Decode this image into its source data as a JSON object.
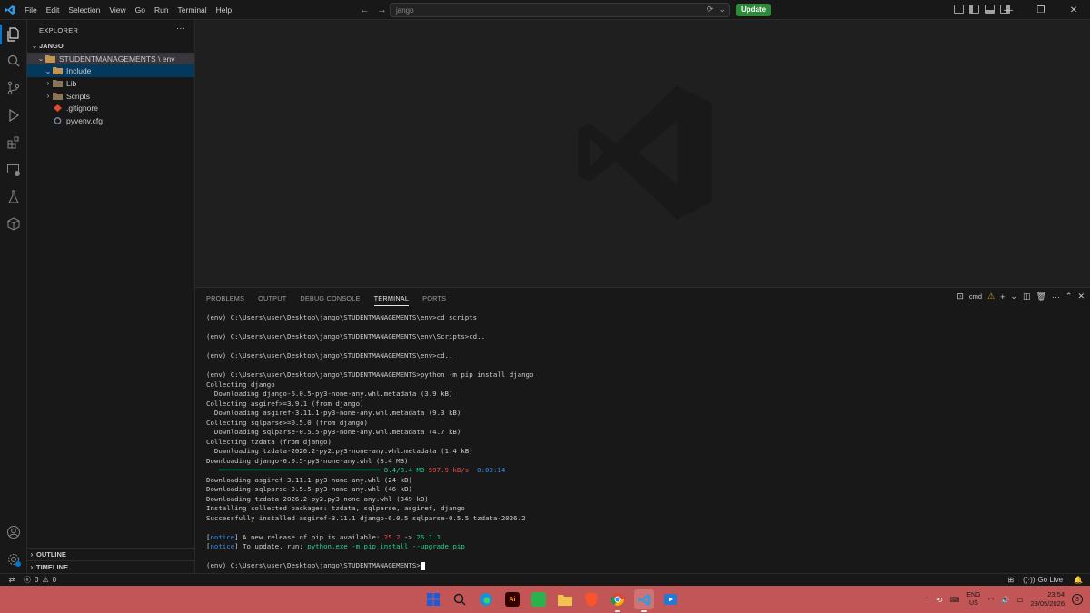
{
  "titlebar": {
    "menus": [
      "File",
      "Edit",
      "Selection",
      "View",
      "Go",
      "Run",
      "Terminal",
      "Help"
    ],
    "search_text": "jango",
    "update_label": "Update"
  },
  "sidebar": {
    "title": "EXPLORER",
    "workspace": "JANGO",
    "tree": [
      {
        "label": "STUDENTMANAGEMENTS \\ env",
        "indent": 0,
        "kind": "folder-open",
        "state": "selected"
      },
      {
        "label": "Include",
        "indent": 1,
        "kind": "folder-open",
        "state": "focused"
      },
      {
        "label": "Lib",
        "indent": 1,
        "kind": "folder",
        "state": ""
      },
      {
        "label": "Scripts",
        "indent": 1,
        "kind": "folder",
        "state": ""
      },
      {
        "label": ".gitignore",
        "indent": 1,
        "kind": "git",
        "state": ""
      },
      {
        "label": "pyvenv.cfg",
        "indent": 1,
        "kind": "gear",
        "state": ""
      }
    ],
    "outline_label": "OUTLINE",
    "timeline_label": "TIMELINE"
  },
  "panel": {
    "tabs": [
      "PROBLEMS",
      "OUTPUT",
      "DEBUG CONSOLE",
      "TERMINAL",
      "PORTS"
    ],
    "active_tab": "TERMINAL",
    "shell_label": "cmd",
    "terminal": {
      "lines": [
        "(env) C:\\Users\\user\\Desktop\\jango\\STUDENTMANAGEMENTS\\env>cd scripts",
        "",
        "(env) C:\\Users\\user\\Desktop\\jango\\STUDENTMANAGEMENTS\\env\\Scripts>cd..",
        "",
        "(env) C:\\Users\\user\\Desktop\\jango\\STUDENTMANAGEMENTS\\env>cd..",
        "",
        "(env) C:\\Users\\user\\Desktop\\jango\\STUDENTMANAGEMENTS>python -m pip install django",
        "Collecting django",
        "  Downloading django-6.0.5-py3-none-any.whl.metadata (3.9 kB)",
        "Collecting asgiref>=3.9.1 (from django)",
        "  Downloading asgiref-3.11.1-py3-none-any.whl.metadata (9.3 kB)",
        "Collecting sqlparse>=0.5.0 (from django)",
        "  Downloading sqlparse-0.5.5-py3-none-any.whl.metadata (4.7 kB)",
        "Collecting tzdata (from django)",
        "  Downloading tzdata-2026.2-py2.py3-none-any.whl.metadata (1.4 kB)",
        "Downloading django-6.0.5-py3-none-any.whl (8.4 MB)"
      ],
      "progress_bar": "   ━━━━━━━━━━━━━━━━━━━━━━━━━━━━━━━━━━━━━━━━ ",
      "progress_size": "8.4/8.4 MB",
      "progress_speed": "597.9 kB/s",
      "progress_eta": "0:00:14",
      "lines_after": [
        "Downloading asgiref-3.11.1-py3-none-any.whl (24 kB)",
        "Downloading sqlparse-0.5.5-py3-none-any.whl (46 kB)",
        "Downloading tzdata-2026.2-py2.py3-none-any.whl (349 kB)",
        "Installing collected packages: tzdata, sqlparse, asgiref, django",
        "Successfully installed asgiref-3.11.1 django-6.0.5 sqlparse-0.5.5 tzdata-2026.2",
        ""
      ],
      "notice_tag": "notice",
      "notice1_text": " A new release of pip is available: ",
      "notice1_old": "25.2",
      "notice1_arrow": " -> ",
      "notice1_new": "26.1.1",
      "notice2_text": " To update, run: ",
      "notice2_cmd": "python.exe -m pip install --upgrade pip",
      "prompt": "(env) C:\\Users\\user\\Desktop\\jango\\STUDENTMANAGEMENTS>"
    }
  },
  "statusbar": {
    "errors": "0",
    "warnings": "0",
    "go_live": "Go Live"
  },
  "taskbar": {
    "lang_top": "ENG",
    "lang_bottom": "US",
    "time": "23:54",
    "date": "29/05/2026",
    "notifications": "3"
  },
  "colors": {
    "accent": "#0078d4",
    "update_button": "#2e8a3b",
    "taskbar": "#c25555"
  }
}
